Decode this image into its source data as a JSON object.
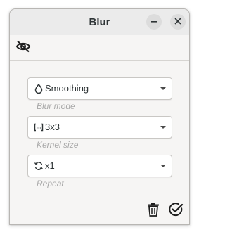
{
  "window": {
    "title": "Blur",
    "minimize_icon": "minimize-icon",
    "close_icon": "close-icon"
  },
  "toolbar": {
    "visibility_icon": "eye-off-icon"
  },
  "fields": {
    "mode": {
      "value": "Smoothing",
      "hint": "Blur mode",
      "icon": "drop-icon"
    },
    "kernel": {
      "value": "3x3",
      "hint": "Kernel size",
      "icon": "matrix-icon"
    },
    "repeat": {
      "value": "x1",
      "hint": "Repeat",
      "icon": "repeat-icon"
    }
  },
  "actions": {
    "delete_icon": "trash-icon",
    "apply_icon": "check-circle-icon"
  },
  "colors": {
    "text": "#2e3436",
    "hint": "#a8a8a8",
    "window_bg": "#f6f5f4",
    "titlebar_bg": "#ebebeb"
  }
}
